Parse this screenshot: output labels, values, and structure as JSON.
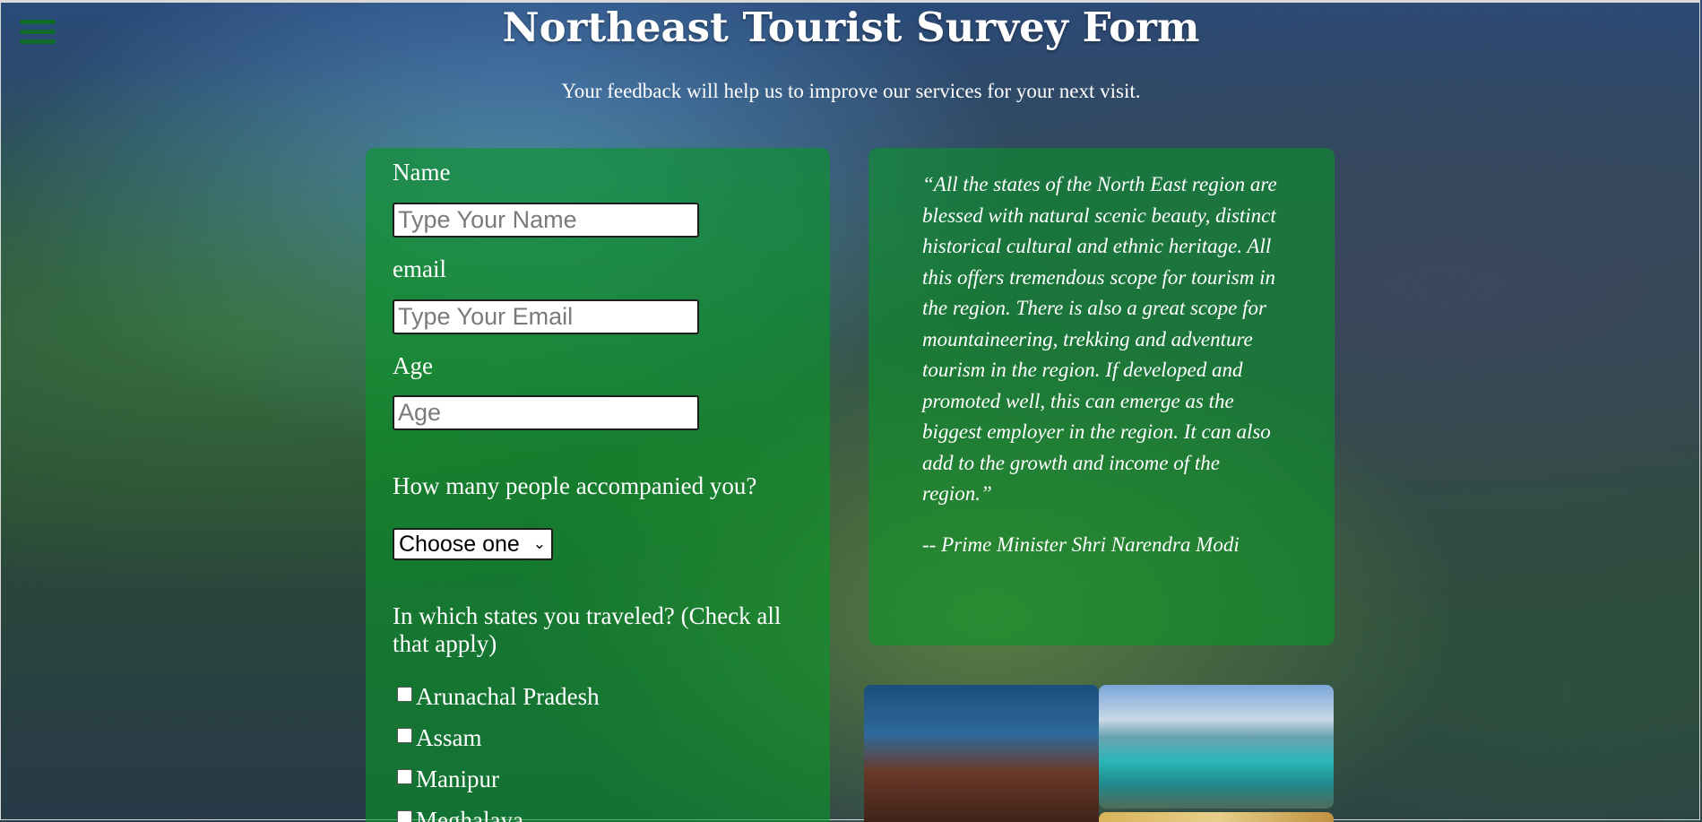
{
  "header": {
    "title": "Northeast Tourist Survey Form",
    "subtitle": "Your feedback will help us to improve our services for your next visit.",
    "menu_icon": "hamburger-menu-icon"
  },
  "form": {
    "name_label": "Name",
    "name_placeholder": "Type Your Name",
    "email_label": "email",
    "email_placeholder": "Type Your Email",
    "age_label": "Age",
    "age_placeholder": "Age",
    "accompany_question": "How many people accompanied you?",
    "accompany_select_value": "Choose one",
    "states_question": "In which states you traveled? (Check all that apply)",
    "states": [
      "Arunachal Pradesh",
      "Assam",
      "Manipur",
      "Meghalaya"
    ]
  },
  "quote": {
    "text": "“All the states of the North East region are blessed with natural scenic beauty, distinct historical cultural and ethnic heritage. All this offers tremendous scope for tourism in the region. There is also a great scope for mountaineering, trekking and adventure tourism in the region. If developed and promoted well, this can emerge as the biggest employer in the region. It can also add to the growth and income of the region.”",
    "author": "-- Prime Minister Shri Narendra Modi"
  },
  "colors": {
    "panel_green": "#089628",
    "menu_green": "#0e6b2a",
    "text": "#ffffff"
  }
}
